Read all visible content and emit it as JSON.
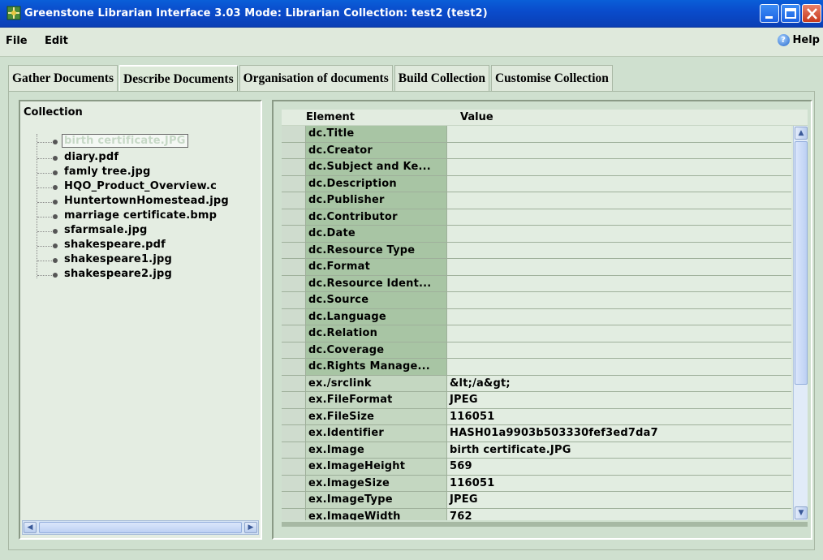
{
  "window": {
    "title": "Greenstone Librarian Interface 3.03  Mode: Librarian  Collection: test2 (test2)"
  },
  "menu": {
    "file": "File",
    "edit": "Edit",
    "help": "Help"
  },
  "tabs": [
    {
      "label": "Gather Documents",
      "active": false
    },
    {
      "label": "Describe Documents",
      "active": true
    },
    {
      "label": "Organisation of documents",
      "active": false
    },
    {
      "label": "Build Collection",
      "active": false
    },
    {
      "label": "Customise Collection",
      "active": false
    }
  ],
  "collection": {
    "header": "Collection",
    "items": [
      {
        "label": "birth certificate.JPG",
        "selected": true
      },
      {
        "label": "diary.pdf"
      },
      {
        "label": "famly tree.jpg"
      },
      {
        "label": "HQO_Product_Overview.c"
      },
      {
        "label": "HuntertownHomestead.jpg"
      },
      {
        "label": "marriage certificate.bmp"
      },
      {
        "label": "sfarmsale.jpg"
      },
      {
        "label": "shakespeare.pdf"
      },
      {
        "label": "shakespeare1.jpg"
      },
      {
        "label": "shakespeare2.jpg"
      }
    ]
  },
  "metadata": {
    "col_element": "Element",
    "col_value": "Value",
    "rows": [
      {
        "element": "dc.Title",
        "value": ""
      },
      {
        "element": "dc.Creator",
        "value": ""
      },
      {
        "element": "dc.Subject and Ke...",
        "value": ""
      },
      {
        "element": "dc.Description",
        "value": ""
      },
      {
        "element": "dc.Publisher",
        "value": ""
      },
      {
        "element": "dc.Contributor",
        "value": ""
      },
      {
        "element": "dc.Date",
        "value": ""
      },
      {
        "element": "dc.Resource Type",
        "value": ""
      },
      {
        "element": "dc.Format",
        "value": ""
      },
      {
        "element": "dc.Resource Ident...",
        "value": ""
      },
      {
        "element": "dc.Source",
        "value": ""
      },
      {
        "element": "dc.Language",
        "value": ""
      },
      {
        "element": "dc.Relation",
        "value": ""
      },
      {
        "element": "dc.Coverage",
        "value": ""
      },
      {
        "element": "dc.Rights Manage...",
        "value": ""
      },
      {
        "element": "ex./srclink",
        "value": "&lt;/a&gt;"
      },
      {
        "element": "ex.FileFormat",
        "value": "JPEG"
      },
      {
        "element": "ex.FileSize",
        "value": "116051"
      },
      {
        "element": "ex.Identifier",
        "value": "HASH01a9903b503330fef3ed7da7"
      },
      {
        "element": "ex.Image",
        "value": "birth certificate.JPG"
      },
      {
        "element": "ex.ImageHeight",
        "value": "569"
      },
      {
        "element": "ex.ImageSize",
        "value": "116051"
      },
      {
        "element": "ex.ImageType",
        "value": "JPEG"
      },
      {
        "element": "ex.ImageWidth",
        "value": "762"
      }
    ]
  },
  "colors": {
    "titlebar": "#0a4ccc",
    "panel_bg": "#cfe0cf",
    "element_cell": "#a8c5a4"
  }
}
